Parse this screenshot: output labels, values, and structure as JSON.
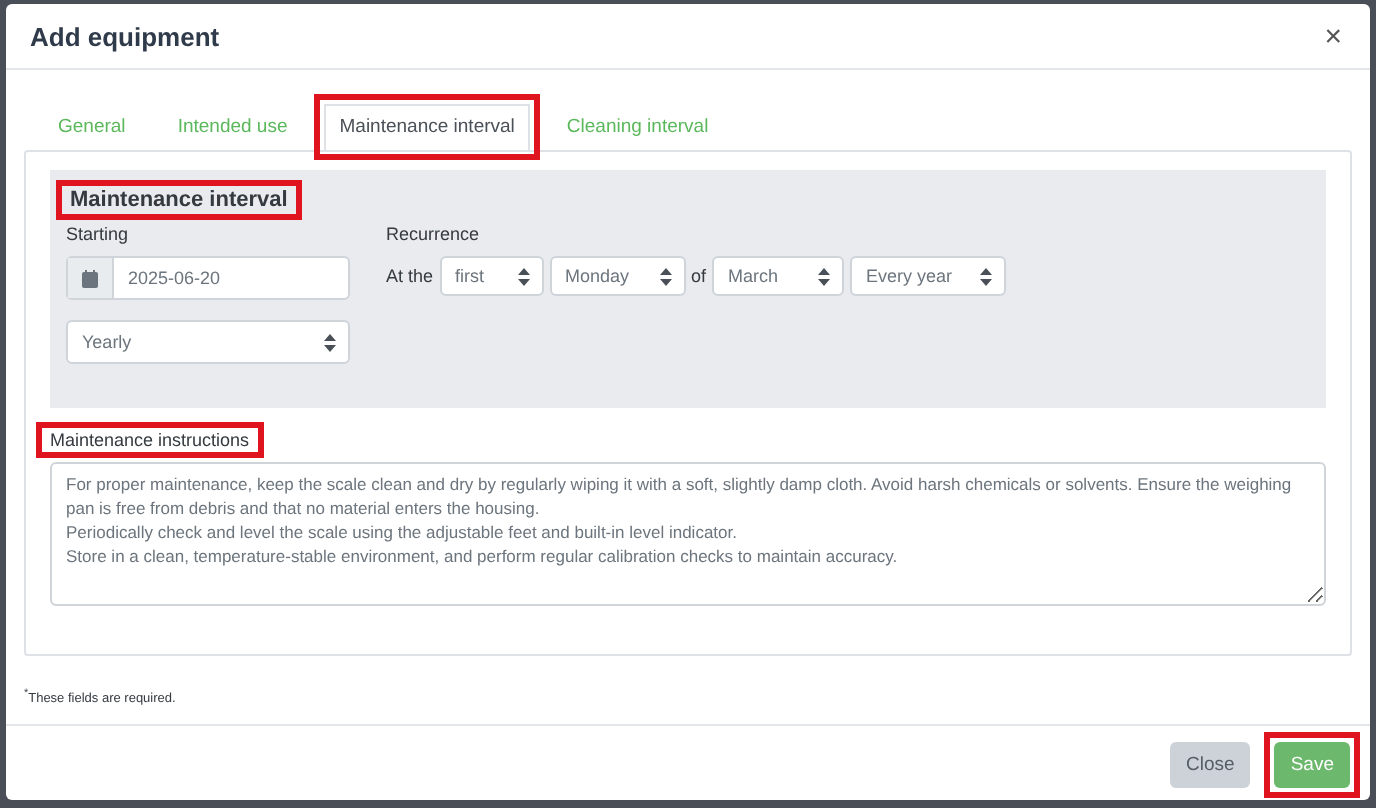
{
  "dialog": {
    "title": "Add equipment",
    "close_symbol": "×"
  },
  "tabs": [
    {
      "label": "General",
      "selected": false,
      "highlighted": false
    },
    {
      "label": "Intended use",
      "selected": false,
      "highlighted": false
    },
    {
      "label": "Maintenance interval",
      "selected": true,
      "highlighted": true
    },
    {
      "label": "Cleaning interval",
      "selected": false,
      "highlighted": false
    }
  ],
  "section": {
    "title": "Maintenance interval",
    "highlighted": true,
    "starting": {
      "label": "Starting",
      "date": "2025-06-20",
      "frequency": "Yearly"
    },
    "recurrence": {
      "label": "Recurrence",
      "prefix": "At the",
      "ordinal": "first",
      "weekday": "Monday",
      "connector": "of",
      "month": "March",
      "repeat": "Every year"
    }
  },
  "instructions": {
    "label": "Maintenance instructions",
    "highlighted": true,
    "value": "For proper maintenance, keep the scale clean and dry by regularly wiping it with a soft, slightly damp cloth. Avoid harsh chemicals or solvents. Ensure the weighing pan is free from debris and that no material enters the housing.\nPeriodically check and level the scale using the adjustable feet and built-in level indicator.\nStore in a clean, temperature-stable environment, and perform regular calibration checks to maintain accuracy."
  },
  "footnote": "$^{*}$These fields are required.",
  "buttons": [
    {
      "label": "Close",
      "kind": "secondary",
      "highlighted": false
    },
    {
      "label": "Save",
      "kind": "primary",
      "highlighted": true
    }
  ]
}
